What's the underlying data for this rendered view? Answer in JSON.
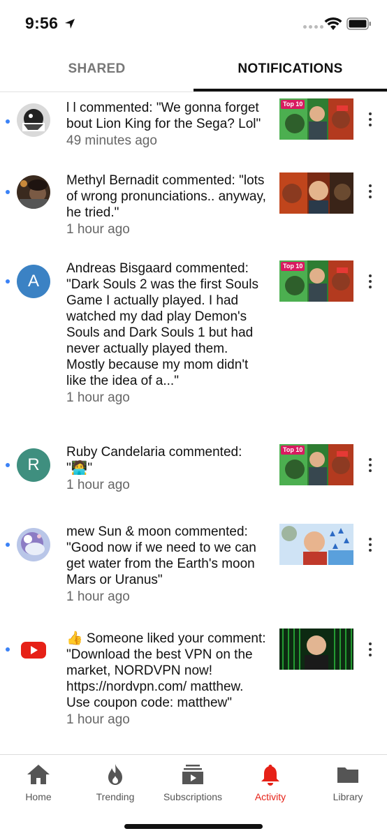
{
  "status_bar": {
    "time": "9:56"
  },
  "tabs": [
    {
      "label": "SHARED",
      "active": false
    },
    {
      "label": "NOTIFICATIONS",
      "active": true
    }
  ],
  "notifications": [
    {
      "text": "l l commented: \"We gonna forget bout Lion King for the Sega? Lol\"",
      "time": "49 minutes ago",
      "unread": true,
      "avatar": "photo",
      "thumbnail_badge": "Top 10"
    },
    {
      "text": "Methyl Bernadit commented: \"lots of wrong pronunciations.. anyway, he tried.\"",
      "time": "1 hour ago",
      "unread": true,
      "avatar": "photo"
    },
    {
      "text": "Andreas Bisgaard commented: \"Dark Souls 2 was the first Souls Game I actually played. I had watched my dad play Demon's Souls and Dark Souls 1 but had never actually played them. Mostly because my mom didn't like the idea of a...\"",
      "time": "1 hour ago",
      "unread": true,
      "avatar_letter": "A",
      "avatar_color": "#3b82c4",
      "thumbnail_badge": "Top 10"
    },
    {
      "text": "Ruby Candelaria commented: \"🧑‍💻\"",
      "time": "1 hour ago",
      "unread": true,
      "avatar_letter": "R",
      "avatar_color": "#3f8f7f",
      "thumbnail_badge": "Top 10"
    },
    {
      "text": "mew Sun & moon commented: \"Good now if we need to we can get water from the Earth's moon Mars or Uranus\"",
      "time": "1 hour ago",
      "unread": true,
      "avatar": "photo"
    },
    {
      "text": "👍 Someone liked your comment: \"Download the best VPN on the market, NORDVPN now! https://nordvpn.com/ matthew. Use coupon code: matthew\"",
      "time": "1 hour ago",
      "unread": true,
      "avatar": "youtube-logo"
    }
  ],
  "bottom_nav": [
    {
      "label": "Home",
      "icon": "home-icon",
      "active": false
    },
    {
      "label": "Trending",
      "icon": "flame-icon",
      "active": false
    },
    {
      "label": "Subscriptions",
      "icon": "subscriptions-icon",
      "active": false
    },
    {
      "label": "Activity",
      "icon": "bell-icon",
      "active": true
    },
    {
      "label": "Library",
      "icon": "folder-icon",
      "active": false
    }
  ],
  "colors": {
    "accent": "#e62117",
    "unread_dot": "#3b82f6"
  }
}
